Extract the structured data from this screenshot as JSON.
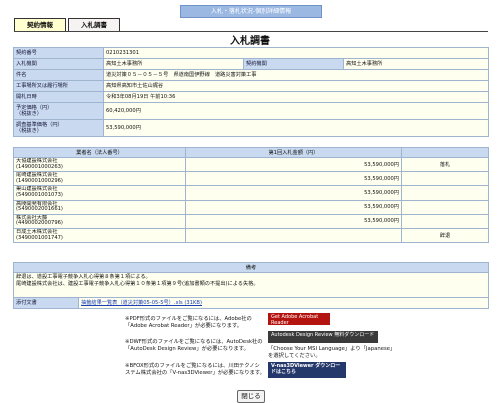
{
  "header": {
    "title": "入札・落札状況-個別詳細情報"
  },
  "tabs": [
    {
      "label": "契約情報"
    },
    {
      "label": "入札調書"
    }
  ],
  "page_title": "入札調書",
  "contract": {
    "rows": [
      {
        "label": "契約番号",
        "value": "0210231301"
      },
      {
        "label": "入札機関",
        "value": "高知土木事務所",
        "label2": "契約機関",
        "value2": "高知土木事務所"
      },
      {
        "label": "件名",
        "value": "道災対策０５－０５－５号　県道南国伊野線　道路災害対策工事"
      },
      {
        "label": "工事場所又は履行場所",
        "value": "高知県高知市土佐山梶谷"
      },
      {
        "label": "開札日時",
        "value": "令和3年08月19日 午前10:36"
      },
      {
        "label": "予定価格（円）\n（税抜き）",
        "value": "60,420,000円"
      },
      {
        "label": "調査基準価格（円）\n（税抜き）",
        "value": "53,590,000円"
      }
    ]
  },
  "bidders": {
    "headers": [
      "業者名（法人番号）",
      "第1回入札金額（円）",
      ""
    ],
    "rows": [
      {
        "name": "大協建設株式会社",
        "id": "(1490001000263)",
        "amount": "53,590,000円",
        "note": "落札"
      },
      {
        "name": "尾崎建設株式会社",
        "id": "(1490001000296)",
        "amount": "53,590,000円",
        "note": ""
      },
      {
        "name": "巣山建設株式会社",
        "id": "(5490001001073)",
        "amount": "53,590,000円",
        "note": ""
      },
      {
        "name": "高陵開発有限会社",
        "id": "(5490002001661)",
        "amount": "53,590,000円",
        "note": ""
      },
      {
        "name": "株式会社大藤",
        "id": "(4490002000796)",
        "amount": "53,590,000円",
        "note": ""
      },
      {
        "name": "日成土木株式会社",
        "id": "(3490001001747)",
        "amount": "",
        "note": "辞退"
      }
    ]
  },
  "notes": {
    "header": "備考",
    "lines": [
      "辞退は、道設工事電子競争入札心得第８条第１項による。",
      "尾崎建設株式会社は、建設工事電子競争入札心得第１０条第１項第９号(追加書類の不提出)による失格。"
    ],
    "attachment_label": "添付文書",
    "attachment_link": "抽籤結果一覧表（道災対策05-05-5号）.xls (31KB)"
  },
  "downloads": {
    "pdf": "※PDF形式のファイルをご覧になるには、Adobe社の「Adobe Acrobat Reader」が必要になります。",
    "dwf": "※DWF形式のファイルをご覧になるには、AutoDesk社の「AutoDesk Design Review」が必要になります。",
    "dwf_note": "「Choose Your MSI Language」より「Japanese」を選択してください。",
    "sfx": "※BFOX形式のファイルをご覧になるには、川田テクノシステム株式会社の「V-nas3DViewer」が必要になります。",
    "badge_adobe": "Get Adobe Acrobat Reader",
    "badge_autodesk": "Autodesk Design Review 無料ダウンロード",
    "badge_vnas": "V-nas3DViewer ダウンロードはこちら",
    "colors": {
      "adobe": "#b3140f",
      "autodesk": "#3a3a3a",
      "vnas": "#24386b"
    }
  },
  "close_label": "閉じる"
}
